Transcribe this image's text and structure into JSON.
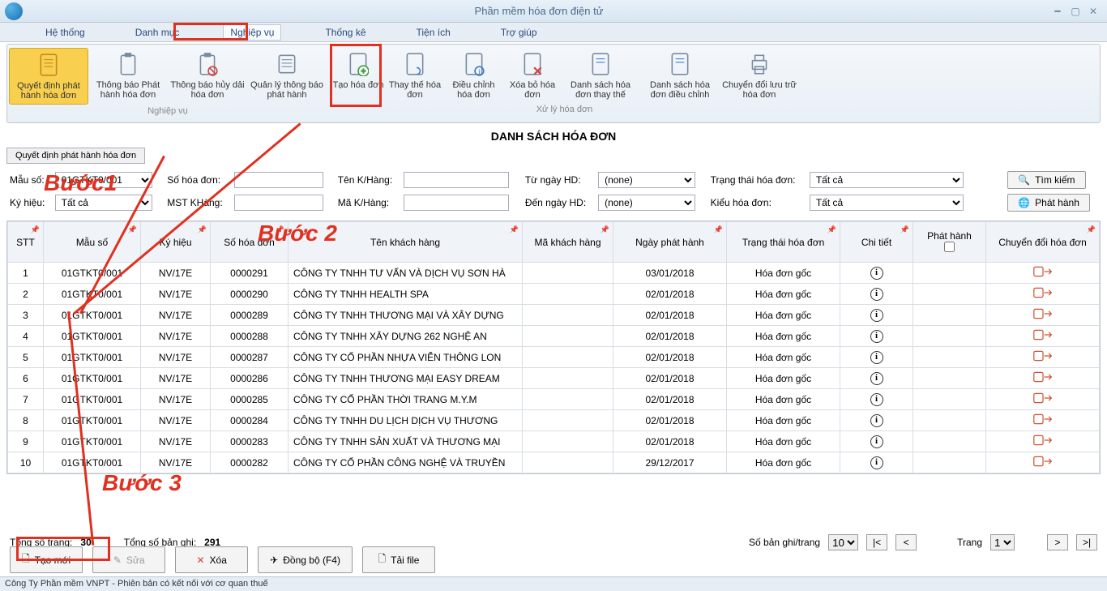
{
  "window": {
    "title": "Phần mềm hóa đơn điện tử"
  },
  "menu": [
    "Hệ thống",
    "Danh mục",
    "Nghiệp vụ",
    "Thống kê",
    "Tiện ích",
    "Trợ giúp"
  ],
  "ribbon": {
    "group1_label": "Nghiệp vụ",
    "group2_label": "Xử lý hóa đơn",
    "items": [
      {
        "label": "Quyết định phát hành hóa đơn",
        "active": true
      },
      {
        "label": "Thông báo Phát hành hóa đơn"
      },
      {
        "label": "Thông báo hủy dải hóa đơn"
      },
      {
        "label": "Quản lý thông báo phát hành"
      },
      {
        "label": "Tạo hóa đơn"
      },
      {
        "label": "Thay thế hóa đơn"
      },
      {
        "label": "Điều chỉnh hóa đơn"
      },
      {
        "label": "Xóa bỏ hóa đơn"
      },
      {
        "label": "Danh sách hóa đơn thay thế"
      },
      {
        "label": "Danh sách hóa đơn điều chỉnh"
      },
      {
        "label": "Chuyển đổi lưu trữ hóa đơn"
      }
    ]
  },
  "section_title": "DANH SÁCH HÓA ĐƠN",
  "breadcrumb": "Quyết định phát hành hóa đơn",
  "filters": {
    "mau_so_label": "Mẫu số:",
    "mau_so_value": "01GTKT0/001",
    "so_hd_label": "Số hóa đơn:",
    "ten_kh_label": "Tên K/Hàng:",
    "tu_ngay_label": "Từ ngày HD:",
    "tu_ngay_value": "(none)",
    "trang_thai_label": "Trạng thái hóa đơn:",
    "trang_thai_value": "Tất cả",
    "ky_hieu_label": "Ký hiệu:",
    "ky_hieu_value": "Tất cả",
    "mst_label": "MST KHàng:",
    "ma_kh_label": "Mã K/Hàng:",
    "den_ngay_label": "Đến ngày HD:",
    "den_ngay_value": "(none)",
    "kieu_label": "Kiểu hóa đơn:",
    "kieu_value": "Tất cả",
    "search_btn": "Tìm kiếm",
    "publish_btn": "Phát hành"
  },
  "columns": [
    "STT",
    "Mẫu số",
    "Ký hiệu",
    "Số hóa đơn",
    "Tên khách hàng",
    "Mã khách hàng",
    "Ngày phát hành",
    "Trạng thái hóa đơn",
    "Chi tiết",
    "Phát hành",
    "Chuyển đổi hóa đơn"
  ],
  "rows": [
    {
      "stt": "1",
      "mau": "01GTKT0/001",
      "ky": "NV/17E",
      "so": "0000291",
      "ten": "CÔNG TY TNHH TƯ VẤN VÀ DỊCH VỤ SƠN HÀ",
      "ma": "",
      "ngay": "03/01/2018",
      "tt": "Hóa đơn gốc"
    },
    {
      "stt": "2",
      "mau": "01GTKT0/001",
      "ky": "NV/17E",
      "so": "0000290",
      "ten": "CÔNG TY TNHH HEALTH SPA",
      "ma": "",
      "ngay": "02/01/2018",
      "tt": "Hóa đơn gốc"
    },
    {
      "stt": "3",
      "mau": "01GTKT0/001",
      "ky": "NV/17E",
      "so": "0000289",
      "ten": "CÔNG TY TNHH THƯƠNG MẠI VÀ XÂY DỰNG",
      "ma": "",
      "ngay": "02/01/2018",
      "tt": "Hóa đơn gốc"
    },
    {
      "stt": "4",
      "mau": "01GTKT0/001",
      "ky": "NV/17E",
      "so": "0000288",
      "ten": "CÔNG TY TNHH XÂY DỰNG 262 NGHỆ AN",
      "ma": "",
      "ngay": "02/01/2018",
      "tt": "Hóa đơn gốc"
    },
    {
      "stt": "5",
      "mau": "01GTKT0/001",
      "ky": "NV/17E",
      "so": "0000287",
      "ten": "CÔNG TY CỔ PHẦN NHỰA VIỄN THÔNG LON",
      "ma": "",
      "ngay": "02/01/2018",
      "tt": "Hóa đơn gốc"
    },
    {
      "stt": "6",
      "mau": "01GTKT0/001",
      "ky": "NV/17E",
      "so": "0000286",
      "ten": "CÔNG TY TNHH THƯƠNG MẠI EASY DREAM",
      "ma": "",
      "ngay": "02/01/2018",
      "tt": "Hóa đơn gốc"
    },
    {
      "stt": "7",
      "mau": "01GTKT0/001",
      "ky": "NV/17E",
      "so": "0000285",
      "ten": "CÔNG TY CỔ PHẦN THỜI TRANG M.Y.M",
      "ma": "",
      "ngay": "02/01/2018",
      "tt": "Hóa đơn gốc"
    },
    {
      "stt": "8",
      "mau": "01GTKT0/001",
      "ky": "NV/17E",
      "so": "0000284",
      "ten": "CÔNG TY TNHH DU LỊCH DỊCH VỤ THƯƠNG",
      "ma": "",
      "ngay": "02/01/2018",
      "tt": "Hóa đơn gốc"
    },
    {
      "stt": "9",
      "mau": "01GTKT0/001",
      "ky": "NV/17E",
      "so": "0000283",
      "ten": "CÔNG TY TNHH SẢN XUẤT VÀ THƯƠNG MẠI",
      "ma": "",
      "ngay": "02/01/2018",
      "tt": "Hóa đơn gốc"
    },
    {
      "stt": "10",
      "mau": "01GTKT0/001",
      "ky": "NV/17E",
      "so": "0000282",
      "ten": "CÔNG TY CỔ PHẦN CÔNG NGHỆ VÀ TRUYỀN",
      "ma": "",
      "ngay": "29/12/2017",
      "tt": "Hóa đơn gốc"
    }
  ],
  "pager": {
    "total_pages_label": "Tổng số trang:",
    "total_pages": "30",
    "total_records_label": "Tổng số bản ghi:",
    "total_records": "291",
    "per_page_label": "Số bản ghi/trang",
    "per_page": "10",
    "page_label": "Trang",
    "page": "1"
  },
  "bottom": {
    "new": "Tạo mới",
    "edit": "Sửa",
    "delete": "Xóa",
    "sync": "Đồng bộ (F4)",
    "upload": "Tải file"
  },
  "status": "Công Ty Phần mềm VNPT - Phiên bản có kết nối với cơ quan thuế",
  "annotations": {
    "step1": "Bước1",
    "step2": "Bước 2",
    "step3": "Bước 3"
  }
}
